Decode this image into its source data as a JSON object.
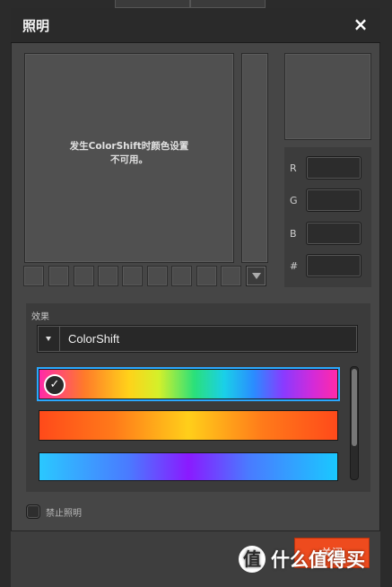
{
  "dialog": {
    "title": "照明",
    "close_glyph": "×"
  },
  "color_picker": {
    "unavailable_text_line1": "发生ColorShift时颜色设置",
    "unavailable_text_line2": "不可用。",
    "channels": [
      {
        "label": "R",
        "value": ""
      },
      {
        "label": "G",
        "value": ""
      },
      {
        "label": "B",
        "value": ""
      },
      {
        "label": "#",
        "value": ""
      }
    ]
  },
  "effect": {
    "label": "效果",
    "selected": "ColorShift",
    "gradients": [
      {
        "name": "rainbow",
        "selected": true,
        "css": "linear-gradient(90deg,#ff2aa8 0%,#ff7a2a 15%,#ffd21a 30%,#d4f02a 40%,#2ae07a 52%,#1ad0e8 62%,#2a8cff 72%,#8a3aff 82%,#d42ad8 92%,#ff2aa8 100%)"
      },
      {
        "name": "fire",
        "selected": false,
        "css": "linear-gradient(90deg,#ff4a1a 0%,#ff7a1a 25%,#ffcf1a 50%,#ff7a1a 75%,#ff4a1a 100%)"
      },
      {
        "name": "ocean",
        "selected": false,
        "css": "linear-gradient(90deg,#2ac8ff 0%,#4a7aff 30%,#8a1aff 50%,#4a7aff 70%,#1ac8ff 100%)"
      }
    ],
    "scroll_position": 0
  },
  "disable_lighting": {
    "label": "禁止照明",
    "checked": false
  },
  "footer": {
    "close_label": "关闭"
  },
  "watermark": {
    "logo_glyph": "值",
    "text": "什么值得买"
  }
}
